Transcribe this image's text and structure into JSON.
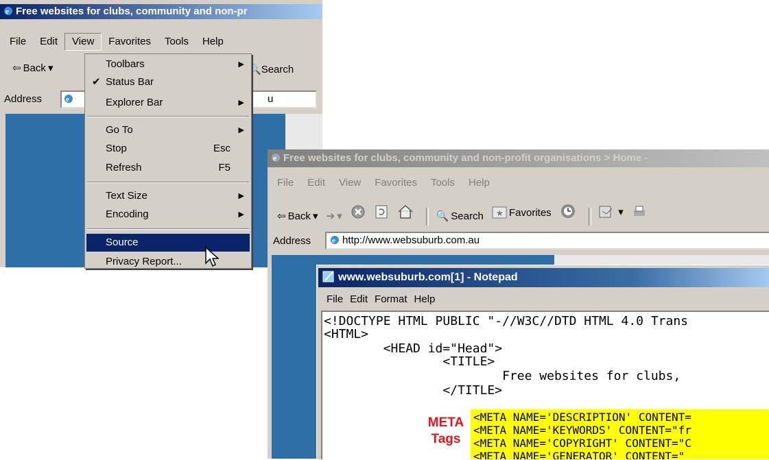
{
  "browser_back": {
    "title": "Free websites for clubs, community and non-pr",
    "menu": [
      "File",
      "Edit",
      "View",
      "Favorites",
      "Tools",
      "Help"
    ],
    "toolbar": {
      "back": "Back",
      "search": "Search"
    },
    "address_label": "Address",
    "address_value": "u"
  },
  "view_menu": {
    "items": [
      {
        "label": "Toolbars",
        "arrow": "▶"
      },
      {
        "label": "Status Bar",
        "check": "✔"
      },
      {
        "label": "Explorer Bar",
        "arrow": "▶"
      },
      {
        "label": "Go To",
        "arrow": "▶"
      },
      {
        "label": "Stop",
        "shortcut": "Esc"
      },
      {
        "label": "Refresh",
        "shortcut": "F5"
      },
      {
        "label": "Text Size",
        "arrow": "▶"
      },
      {
        "label": "Encoding",
        "arrow": "▶"
      },
      {
        "label": "Source"
      },
      {
        "label": "Privacy Report..."
      }
    ]
  },
  "browser_front": {
    "title": "Free websites for clubs, community and non-profit organisations > Home -",
    "menu": [
      "File",
      "Edit",
      "View",
      "Favorites",
      "Tools",
      "Help"
    ],
    "toolbar": {
      "back": "Back",
      "search": "Search",
      "favorites": "Favorites"
    },
    "address_label": "Address",
    "address_value": "http://www.websuburb.com.au"
  },
  "notepad": {
    "title": "www.websuburb.com[1] - Notepad",
    "menu": [
      "File",
      "Edit",
      "Format",
      "Help"
    ],
    "lines": [
      "<!DOCTYPE HTML PUBLIC \"-//W3C//DTD HTML 4.0 Trans",
      "<HTML>",
      "        <HEAD id=\"Head\">",
      "                <TITLE>",
      "                        Free websites for clubs,",
      "                </TITLE>"
    ],
    "meta_lines": [
      "<META NAME='DESCRIPTION' CONTENT=",
      "<META NAME='KEYWORDS' CONTENT=\"fr",
      "<META NAME='COPYRIGHT' CONTENT=\"C",
      "<META NAME='GENERATOR' CONTENT=\""
    ]
  },
  "annotation": {
    "line1": "META",
    "line2": "Tags",
    "color": "#e8141c"
  },
  "colors": {
    "title_blue": "#0a246a",
    "desktop_blue": "#3a6ea5",
    "highlight": "#ffff00",
    "menu_select": "#0a246a"
  }
}
